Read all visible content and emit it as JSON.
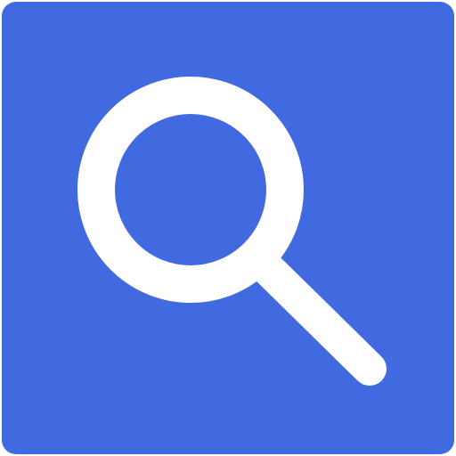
{
  "icon": {
    "name": "search-icon",
    "background_color": "#416AE1",
    "glyph_color": "#FFFFFF"
  }
}
